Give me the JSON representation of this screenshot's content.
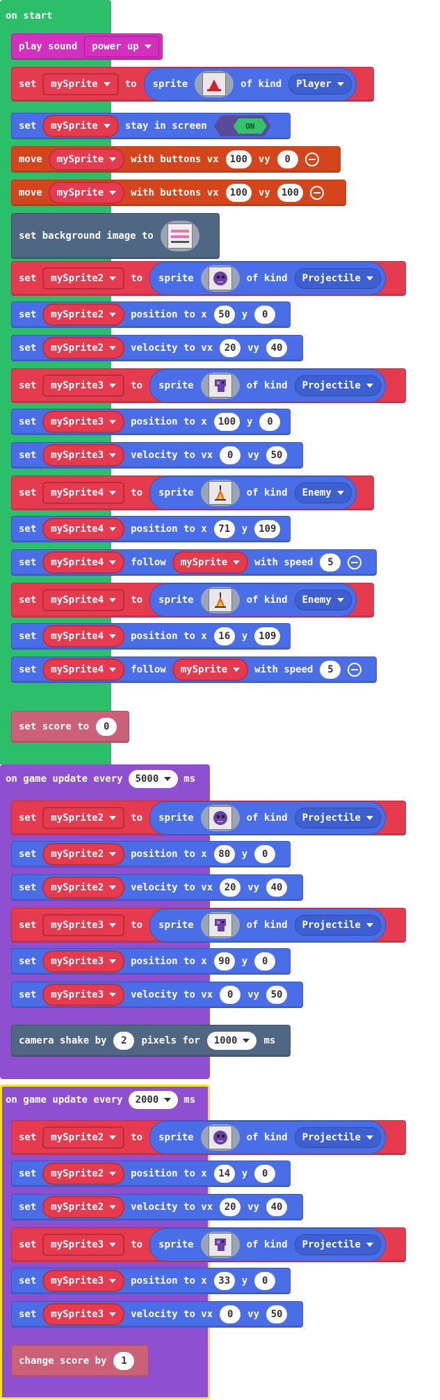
{
  "on_start": {
    "label": "on start",
    "color": "#2bbf6a",
    "play_sound": {
      "label": "play sound",
      "sound": "power up"
    },
    "set_player": {
      "set": "set",
      "var": "mySprite",
      "to": "to",
      "sprite": "sprite",
      "of_kind": "of kind",
      "kind": "Player"
    },
    "stay": {
      "set": "set",
      "var": "mySprite",
      "text": "stay in screen",
      "state": "ON"
    },
    "move1": {
      "move": "move",
      "var": "mySprite",
      "text": "with buttons vx",
      "vx": "100",
      "vy_label": "vy",
      "vy": "0"
    },
    "move2": {
      "move": "move",
      "var": "mySprite",
      "text": "with buttons vx",
      "vx": "100",
      "vy_label": "vy",
      "vy": "100"
    },
    "background": {
      "label": "set background image to"
    },
    "rows": [
      {
        "set": "set",
        "var": "mySprite2",
        "to": "to",
        "sprite": "sprite",
        "of_kind": "of kind",
        "kind": "Projectile"
      },
      {
        "set": "set",
        "var": "mySprite2",
        "text": "position to x",
        "a": "50",
        "b_label": "y",
        "b": "0"
      },
      {
        "set": "set",
        "var": "mySprite2",
        "text": "velocity to vx",
        "a": "20",
        "b_label": "vy",
        "b": "40"
      },
      {
        "set": "set",
        "var": "mySprite3",
        "to": "to",
        "sprite": "sprite",
        "of_kind": "of kind",
        "kind": "Projectile"
      },
      {
        "set": "set",
        "var": "mySprite3",
        "text": "position to x",
        "a": "100",
        "b_label": "y",
        "b": "0"
      },
      {
        "set": "set",
        "var": "mySprite3",
        "text": "velocity to vx",
        "a": "0",
        "b_label": "vy",
        "b": "50"
      },
      {
        "set": "set",
        "var": "mySprite4",
        "to": "to",
        "sprite": "sprite",
        "of_kind": "of kind",
        "kind": "Enemy"
      },
      {
        "set": "set",
        "var": "mySprite4",
        "text": "position to x",
        "a": "71",
        "b_label": "y",
        "b": "109"
      },
      {
        "set": "set",
        "var": "mySprite4",
        "follow": "follow",
        "target": "mySprite",
        "speed_label": "with speed",
        "speed": "5"
      },
      {
        "set": "set",
        "var": "mySprite4",
        "to": "to",
        "sprite": "sprite",
        "of_kind": "of kind",
        "kind": "Enemy"
      },
      {
        "set": "set",
        "var": "mySprite4",
        "text": "position to x",
        "a": "16",
        "b_label": "y",
        "b": "109"
      },
      {
        "set": "set",
        "var": "mySprite4",
        "follow": "follow",
        "target": "mySprite",
        "speed_label": "with speed",
        "speed": "5"
      }
    ],
    "score": {
      "label": "set score to",
      "value": "0"
    }
  },
  "update1": {
    "label": "on game update every",
    "interval": "5000",
    "unit": "ms",
    "color": "#8e4fd0",
    "rows": [
      {
        "set": "set",
        "var": "mySprite2",
        "to": "to",
        "sprite": "sprite",
        "of_kind": "of kind",
        "kind": "Projectile"
      },
      {
        "set": "set",
        "var": "mySprite2",
        "text": "position to x",
        "a": "80",
        "b_label": "y",
        "b": "0"
      },
      {
        "set": "set",
        "var": "mySprite2",
        "text": "velocity to vx",
        "a": "20",
        "b_label": "vy",
        "b": "40"
      },
      {
        "set": "set",
        "var": "mySprite3",
        "to": "to",
        "sprite": "sprite",
        "of_kind": "of kind",
        "kind": "Projectile"
      },
      {
        "set": "set",
        "var": "mySprite3",
        "text": "position to x",
        "a": "90",
        "b_label": "y",
        "b": "0"
      },
      {
        "set": "set",
        "var": "mySprite3",
        "text": "velocity to vx",
        "a": "0",
        "b_label": "vy",
        "b": "50"
      }
    ],
    "shake": {
      "label": "camera shake by",
      "amount": "2",
      "mid": "pixels for",
      "duration": "1000",
      "unit": "ms"
    }
  },
  "update2": {
    "label": "on game update every",
    "interval": "2000",
    "unit": "ms",
    "color": "#8e4fd0",
    "highlight": "#f7e11b",
    "rows": [
      {
        "set": "set",
        "var": "mySprite2",
        "to": "to",
        "sprite": "sprite",
        "of_kind": "of kind",
        "kind": "Projectile"
      },
      {
        "set": "set",
        "var": "mySprite2",
        "text": "position to x",
        "a": "14",
        "b_label": "y",
        "b": "0"
      },
      {
        "set": "set",
        "var": "mySprite2",
        "text": "velocity to vx",
        "a": "20",
        "b_label": "vy",
        "b": "40"
      },
      {
        "set": "set",
        "var": "mySprite3",
        "to": "to",
        "sprite": "sprite",
        "of_kind": "of kind",
        "kind": "Projectile"
      },
      {
        "set": "set",
        "var": "mySprite3",
        "text": "position to x",
        "a": "33",
        "b_label": "y",
        "b": "0"
      },
      {
        "set": "set",
        "var": "mySprite3",
        "text": "velocity to vx",
        "a": "0",
        "b_label": "vy",
        "b": "50"
      }
    ],
    "change": {
      "label": "change score by",
      "value": "1"
    }
  }
}
